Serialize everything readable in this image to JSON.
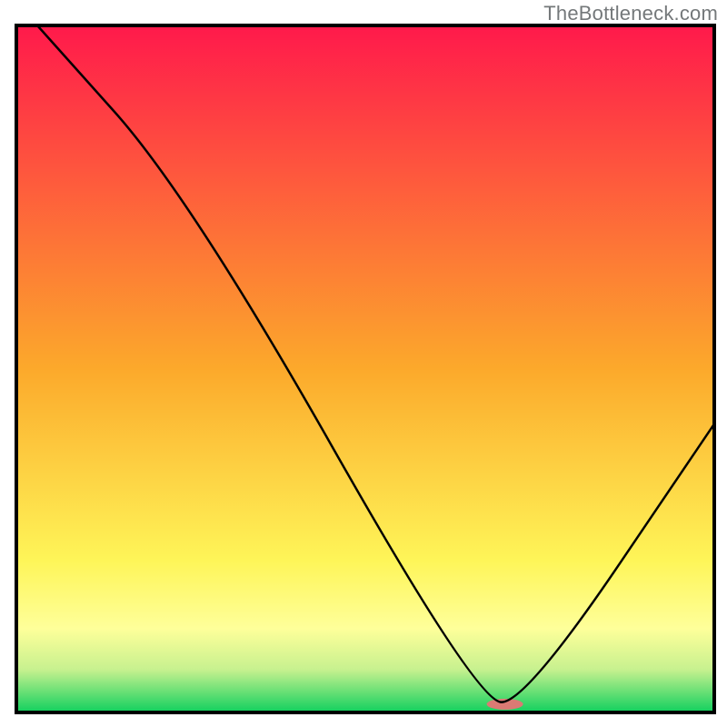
{
  "watermark": "TheBottleneck.com",
  "chart_data": {
    "type": "line",
    "title": "",
    "xlabel": "",
    "ylabel": "",
    "xlim": [
      0,
      100
    ],
    "ylim": [
      0,
      100
    ],
    "x": [
      3,
      25,
      66,
      73,
      100
    ],
    "values": [
      100,
      75,
      1.5,
      1.5,
      42
    ],
    "gradient_stops": [
      {
        "pos": 0.0,
        "color": "#ff1a4b"
      },
      {
        "pos": 0.5,
        "color": "#fca92b"
      },
      {
        "pos": 0.78,
        "color": "#fef558"
      },
      {
        "pos": 0.88,
        "color": "#feff9a"
      },
      {
        "pos": 0.94,
        "color": "#c7f18f"
      },
      {
        "pos": 1.0,
        "color": "#18d160"
      }
    ],
    "marker": {
      "x": 70,
      "y": 1.2,
      "color": "#db7a74",
      "rx": 20,
      "ry": 6
    },
    "frame_color": "#000000",
    "line_color": "#000000"
  }
}
